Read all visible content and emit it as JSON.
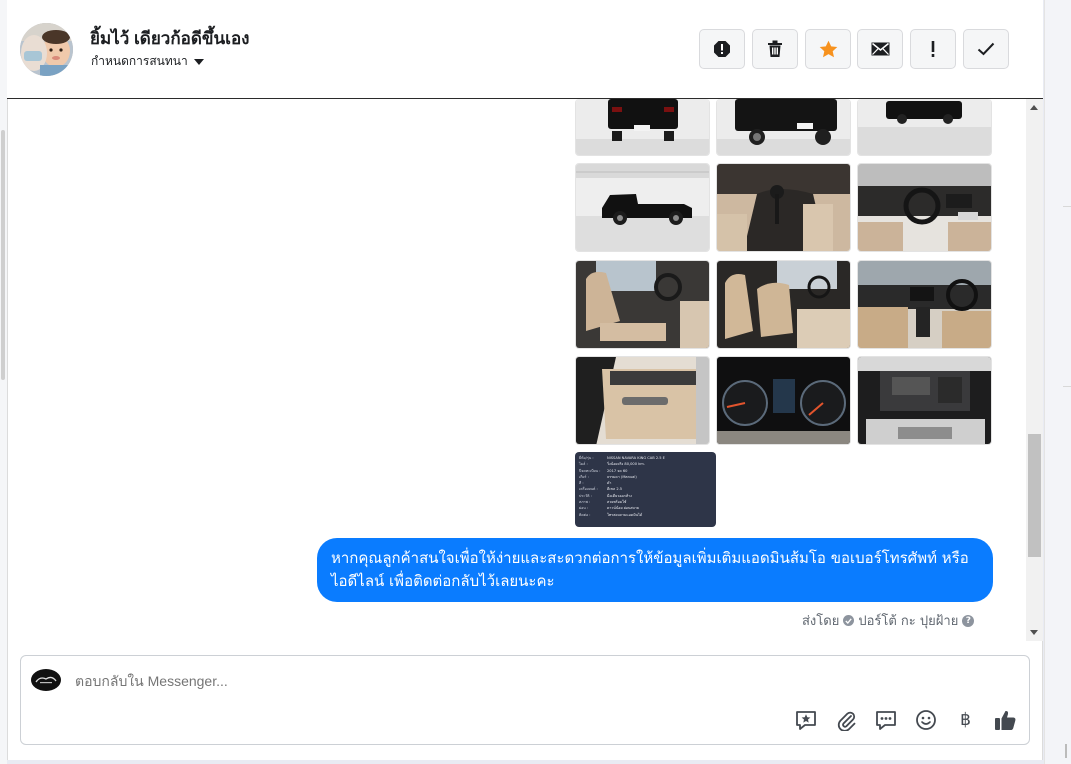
{
  "header": {
    "contact_name": "ยิ้มไว้ เดียวก้อดีขึ้นเอง",
    "assign_label": "กำหนดการสนทนา",
    "actions": [
      {
        "name": "spam-icon",
        "label": "Report"
      },
      {
        "name": "trash-icon",
        "label": "Delete"
      },
      {
        "name": "star-icon",
        "label": "Star"
      },
      {
        "name": "envelope-icon",
        "label": "Mark unread"
      },
      {
        "name": "exclamation-icon",
        "label": "Follow up"
      },
      {
        "name": "check-icon",
        "label": "Done"
      }
    ],
    "star_color": "#f7921e"
  },
  "thread": {
    "photo_grid_rows": 4,
    "photo_grid_cols": 3,
    "spec_sheet": [
      [
        "ยี่ห้อ/รุ่น :",
        "NISSAN NAVARA KING CAB 2.5 E"
      ],
      [
        "ไมล์ :",
        "วิ่งน้อยจริง 80,000 km."
      ],
      [
        "ปีจดทะเบียน :",
        "2017 จด 60"
      ],
      [
        "เกียร์ :",
        "ธรรมดา (Manual)"
      ],
      [
        "สี :",
        "ดำ"
      ],
      [
        "เครื่องยนต์ :",
        "ดีเซล 2.5"
      ],
      [
        "ประวัติ :",
        "มือเดียวออกห้าง"
      ],
      [
        "สภาพ :",
        "สวยพร้อมใช้"
      ],
      [
        "ผ่อน :",
        "ดาวน์น้อย ผ่อนสบาย"
      ],
      [
        "ติดต่อ :",
        "โทรสอบถามแอดมินได้"
      ]
    ],
    "outgoing_message": "หากคุณลูกค้าสนใจเพื่อให้ง่ายและสะดวกต่อการให้ข้อมูลเพิ่มเติมแอดมินส้มโอ ขอเบอร์โทรศัพท์ หรือ ไอดีไลน์ เพื่อติดต่อกลับไว้เลยนะคะ",
    "sent_by_prefix": "ส่งโดย",
    "sent_by_name": "ปอร์โต้ กะ ปุยฝ้าย",
    "bubble_color": "#0a7cff"
  },
  "composer": {
    "placeholder": "ตอบกลับใน Messenger...",
    "icons": [
      "saved-reply-icon",
      "attach-icon",
      "quick-reply-icon",
      "emoji-icon",
      "payment-icon",
      "like-icon"
    ],
    "currency_symbol": "฿"
  }
}
